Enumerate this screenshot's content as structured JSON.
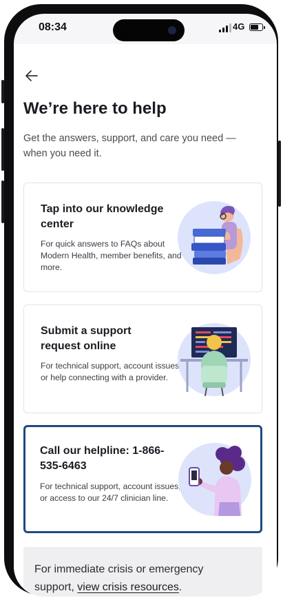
{
  "status_bar": {
    "time": "08:34",
    "network": "4G",
    "battery_level": 0.7
  },
  "header": {
    "title": "We’re here to help",
    "subtitle": "Get the answers, support, and care you need — when you need it."
  },
  "cards": [
    {
      "title": "Tap into our knowledge center",
      "description": "For quick answers to FAQs about Modern Health, member benefits, and more.",
      "illustration": "person-with-books-illustration"
    },
    {
      "title": "Submit a support request online",
      "description": "For technical support, account issues, or help connecting with a provider.",
      "illustration": "person-at-computer-illustration"
    },
    {
      "title": "Call our helpline: 1-866-535-6463",
      "description": "For technical support, account issues, or access to our 24/7 clinician line.",
      "illustration": "person-with-phone-illustration",
      "selected": true
    }
  ],
  "crisis": {
    "prefix": "For immediate crisis or emergency support, ",
    "link": "view crisis resources",
    "suffix": "."
  },
  "colors": {
    "accent": "#1c4a82",
    "illustration_bg": "#dde3fb"
  }
}
